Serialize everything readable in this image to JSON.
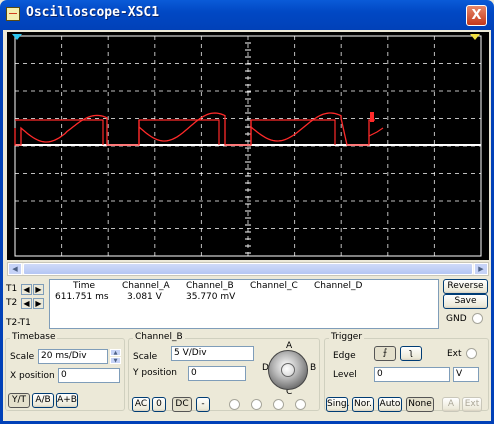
{
  "window": {
    "title": "Oscilloscope-XSC1",
    "close_glyph": "X"
  },
  "screen": {
    "background": "#000000",
    "grid_color": "#ffffff",
    "trace_color": "#ff2a2a",
    "baseline_color": "#ffffff",
    "cursor1_color": "#2cc6f0",
    "cursor2_color": "#f0e040"
  },
  "cursors": {
    "t1": "T1",
    "t2": "T2",
    "t2t1": "T2-T1"
  },
  "readout": {
    "headers": {
      "time": "Time",
      "channel_a": "Channel_A",
      "channel_b": "Channel_B",
      "channel_c": "Channel_C",
      "channel_d": "Channel_D"
    },
    "t1": {
      "time": "611.751 ms",
      "channel_a": "3.081 V",
      "channel_b": "35.770 mV"
    }
  },
  "side_buttons": {
    "reverse": "Reverse",
    "save": "Save",
    "gnd": "GND"
  },
  "timebase": {
    "label": "Timebase",
    "scale_label": "Scale",
    "scale_value": "20 ms/Div",
    "xpos_label": "X position",
    "xpos_value": "0",
    "modes": [
      "Y/T",
      "A/B",
      "A+B"
    ]
  },
  "channel_b": {
    "label": "Channel_B",
    "scale_label": "Scale",
    "scale_value": "5  V/Div",
    "ypos_label": "Y position",
    "ypos_value": "0",
    "coupling": [
      "AC",
      "0",
      "DC",
      "-"
    ],
    "knob_letters": {
      "a": "A",
      "b": "B",
      "c": "C",
      "d": "D"
    }
  },
  "trigger": {
    "label": "Trigger",
    "edge_label": "Edge",
    "ext_label": "Ext",
    "level_label": "Level",
    "level_value": "0",
    "level_unit": "V",
    "modes": [
      "Sing.",
      "Nor.",
      "Auto",
      "None"
    ],
    "source_a": "A",
    "source_ext": "Ext"
  }
}
